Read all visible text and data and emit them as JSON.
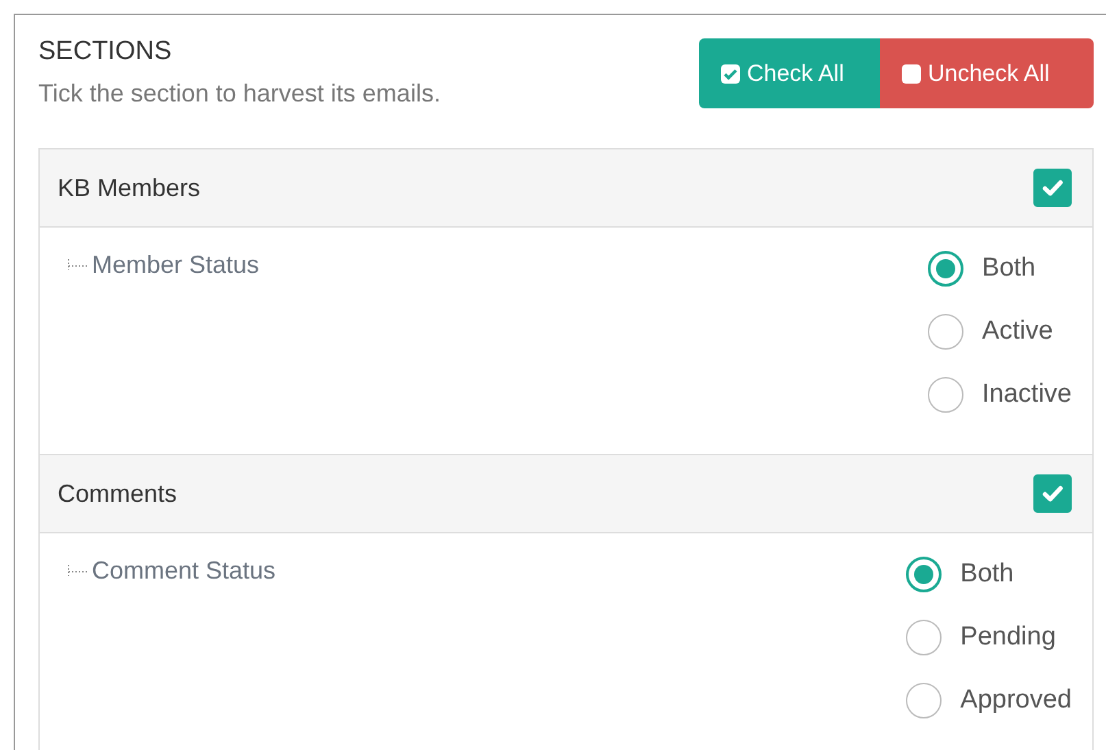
{
  "header": {
    "title": "SECTIONS",
    "hint": "Tick the section to harvest its emails."
  },
  "buttons": [
    {
      "kind": "check",
      "label": "Check All"
    },
    {
      "kind": "uncheck",
      "label": "Uncheck All"
    }
  ],
  "sections": [
    {
      "title": "KB Members",
      "checked": true,
      "field": "Member Status",
      "options": [
        {
          "label": "Both",
          "selected": true
        },
        {
          "label": "Active",
          "selected": false
        },
        {
          "label": "Inactive",
          "selected": false
        }
      ]
    },
    {
      "title": "Comments",
      "checked": true,
      "field": "Comment Status",
      "options": [
        {
          "label": "Both",
          "selected": true
        },
        {
          "label": "Pending",
          "selected": false
        },
        {
          "label": "Approved",
          "selected": false
        }
      ]
    }
  ]
}
